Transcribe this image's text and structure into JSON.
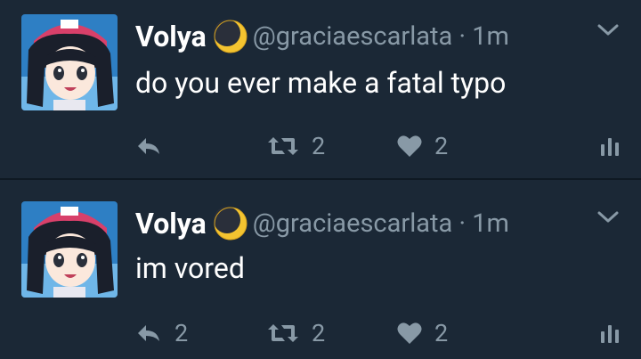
{
  "tweets": [
    {
      "author_name": "Volya",
      "author_emoji": "moon-icon",
      "handle_time": "@graciaescarlata · 1m",
      "text": "do you ever make a fatal typo",
      "reply_count": "",
      "retweet_count": "2",
      "like_count": "2"
    },
    {
      "author_name": "Volya",
      "author_emoji": "moon-icon",
      "handle_time": "@graciaescarlata · 1m",
      "text": "im vored",
      "reply_count": "2",
      "retweet_count": "2",
      "like_count": "2"
    }
  ],
  "colors": {
    "background": "#1b2836",
    "divider": "#0f1923",
    "text_primary": "#ffffff",
    "text_secondary": "#8899a6"
  }
}
